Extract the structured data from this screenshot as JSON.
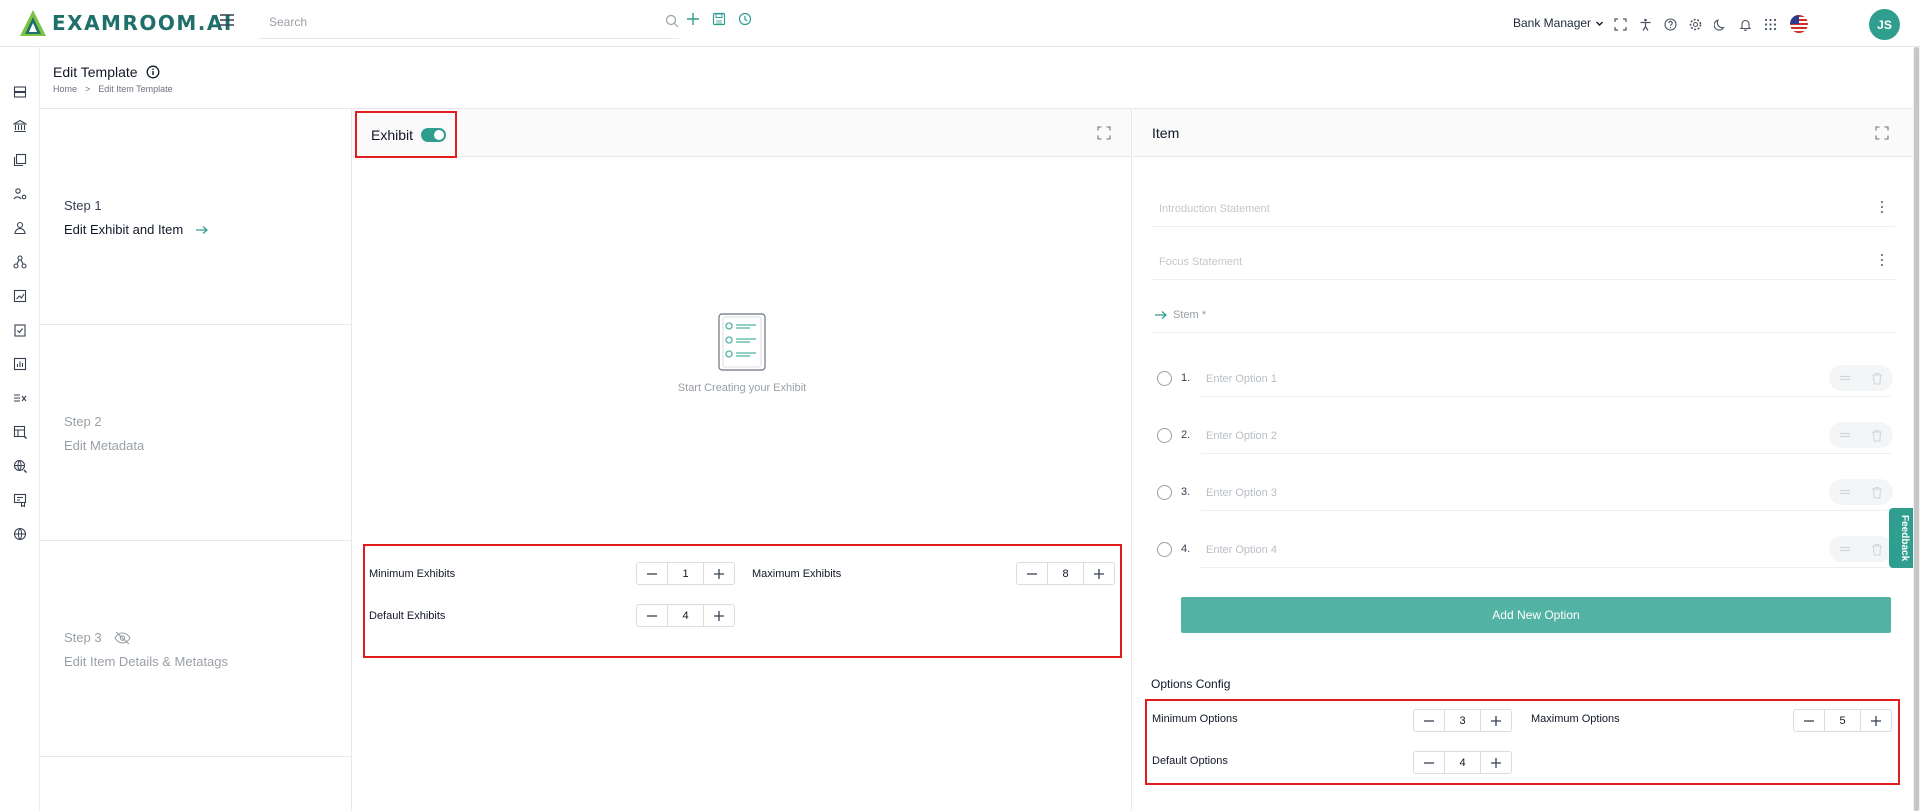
{
  "app": {
    "name": "EXAMROOM.AI",
    "accent": "#2f9e8f",
    "highlight_border": "#e11d1d"
  },
  "topbar": {
    "search_placeholder": "Search",
    "role_label": "Bank Manager",
    "avatar_initials": "JS",
    "icons_left": [
      "add-icon",
      "save-icon",
      "history-icon"
    ],
    "icons_right": [
      "fullscreen-icon",
      "accessibility-icon",
      "help-icon",
      "settings-icon",
      "dark-mode-icon",
      "notification-icon",
      "apps-grid-icon",
      "us-flag-icon"
    ]
  },
  "sidebar": {
    "icons": [
      "server-icon",
      "bank-icon",
      "gallery-icon",
      "users-settings-icon",
      "user-icon",
      "network-icon",
      "chart-line-icon",
      "clipboard-check-icon",
      "report-icon",
      "formula-icon",
      "table-edit-icon",
      "globe-edit-icon",
      "certificate-icon",
      "globe-icon"
    ]
  },
  "header": {
    "title": "Edit Template",
    "breadcrumb": {
      "home": "Home",
      "separator": ">",
      "current": "Edit Item Template"
    }
  },
  "steps": [
    {
      "num": "Step 1",
      "name": "Edit Exhibit and Item",
      "active": true
    },
    {
      "num": "Step 2",
      "name": "Edit Metadata",
      "active": false
    },
    {
      "num": "Step 3",
      "name": "Edit Item Details & Metatags",
      "active": false
    }
  ],
  "exhibit": {
    "title": "Exhibit",
    "toggle_on": true,
    "empty_text": "Start Creating your Exhibit",
    "config": {
      "min_label": "Minimum Exhibits",
      "min_value": "1",
      "max_label": "Maximum Exhibits",
      "max_value": "8",
      "default_label": "Default Exhibits",
      "default_value": "4"
    }
  },
  "item": {
    "title": "Item",
    "intro_placeholder": "Introduction Statement",
    "focus_placeholder": "Focus Statement",
    "stem_label": "Stem *",
    "options": [
      {
        "num": "1.",
        "placeholder": "Enter Option 1"
      },
      {
        "num": "2.",
        "placeholder": "Enter Option 2"
      },
      {
        "num": "3.",
        "placeholder": "Enter Option 3"
      },
      {
        "num": "4.",
        "placeholder": "Enter Option 4"
      }
    ],
    "add_option_label": "Add New Option",
    "options_config": {
      "title": "Options Config",
      "min_label": "Minimum Options",
      "min_value": "3",
      "max_label": "Maximum Options",
      "max_value": "5",
      "default_label": "Default Options",
      "default_value": "4"
    }
  },
  "feedback_label": "Feedback"
}
